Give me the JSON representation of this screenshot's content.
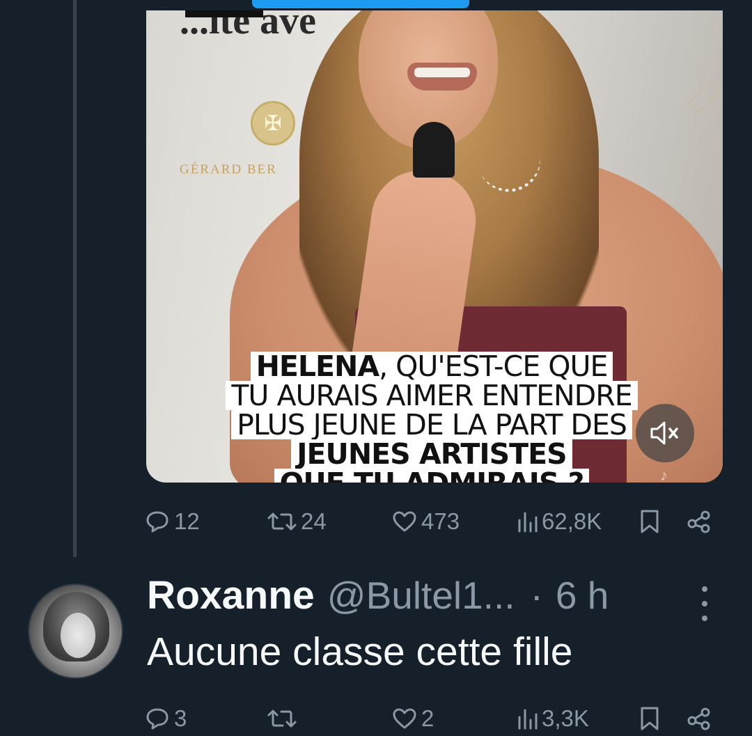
{
  "colors": {
    "background": "#15202b",
    "accent": "#1d9bf0",
    "text_primary": "#f7f9f9",
    "text_secondary": "#8b98a5",
    "thread_line": "#38444d"
  },
  "media": {
    "backdrop_text": "...ite ave",
    "sponsor_text": "GÉRARD BER",
    "caption": {
      "line1_name": "HELENA",
      "line1_rest": ", QU'EST-CE QUE",
      "line2": "TU AURAIS AIMER ENTENDRE",
      "line3": "PLUS JEUNE DE LA PART DES",
      "line4": "JEUNES ARTISTES",
      "line5": "QUE TU ADMIRAIS ?"
    },
    "mute_icon": "volume-muted-icon"
  },
  "tweet_actions": {
    "replies": "12",
    "retweets": "24",
    "likes": "473",
    "views": "62,8K"
  },
  "reply": {
    "display_name": "Roxanne",
    "handle": "@Bultel1...",
    "separator": "·",
    "time": "6 h",
    "text": "Aucune classe cette fille",
    "actions": {
      "replies": "3",
      "retweets": "",
      "likes": "2",
      "views": "3,3K"
    }
  }
}
